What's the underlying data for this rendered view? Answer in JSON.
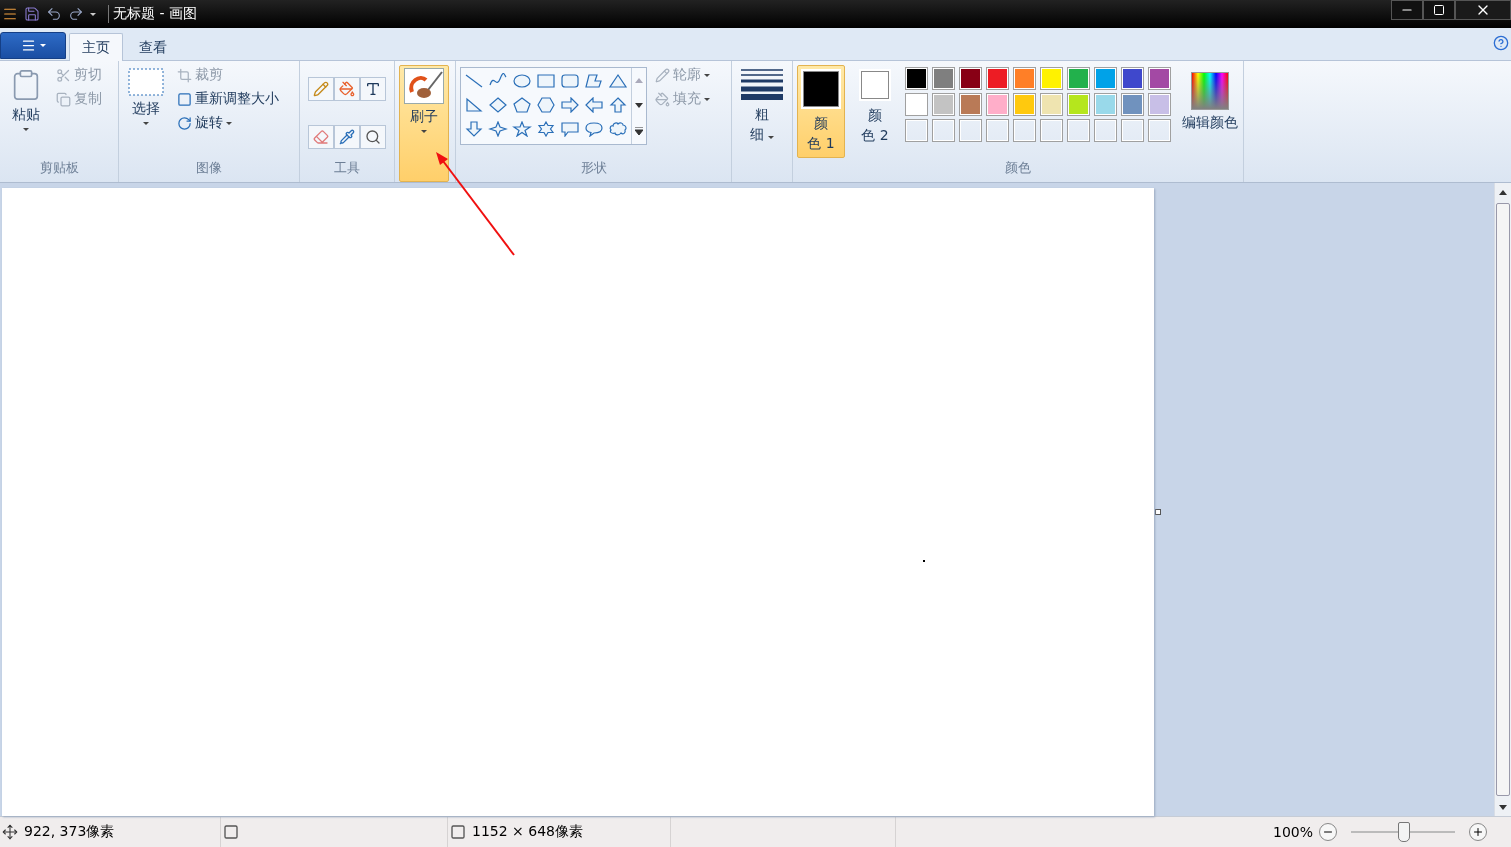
{
  "title_bar": {
    "title": "无标题 - 画图"
  },
  "tabs": [
    {
      "label": "主页",
      "selected": true
    },
    {
      "label": "查看",
      "selected": false
    }
  ],
  "clipboard": {
    "group_label": "剪贴板",
    "paste": "粘贴",
    "items": [
      {
        "label": "剪切",
        "disabled": true
      },
      {
        "label": "复制",
        "disabled": true
      }
    ]
  },
  "image": {
    "group_label": "图像",
    "select": "选择",
    "items": [
      {
        "label": "裁剪",
        "disabled": true,
        "dropdown": false
      },
      {
        "label": "重新调整大小",
        "disabled": false,
        "dropdown": false
      },
      {
        "label": "旋转",
        "disabled": false,
        "dropdown": true
      }
    ]
  },
  "tools": {
    "group_label": "工具"
  },
  "brush": {
    "label": "刷子",
    "selected": true
  },
  "shapes": {
    "group_label": "形状",
    "items": [
      {
        "label": "轮廓",
        "disabled": true
      },
      {
        "label": "填充",
        "disabled": true
      }
    ]
  },
  "size": {
    "lines": [
      "粗",
      "细"
    ]
  },
  "colors": {
    "group_label": "颜色",
    "pickers": [
      {
        "lines": [
          "颜",
          "色 1"
        ],
        "selected": true,
        "color": "#000000"
      },
      {
        "lines": [
          "颜",
          "色 2"
        ],
        "selected": false,
        "color": "#ffffff"
      }
    ],
    "swatches": [
      {
        "kind": "filled",
        "color": "#000000"
      },
      {
        "kind": "filled",
        "color": "#7f7f7f"
      },
      {
        "kind": "filled",
        "color": "#880015"
      },
      {
        "kind": "filled",
        "color": "#ed1c24"
      },
      {
        "kind": "filled",
        "color": "#ff7f27"
      },
      {
        "kind": "filled",
        "color": "#fff200"
      },
      {
        "kind": "filled",
        "color": "#22b14c"
      },
      {
        "kind": "filled",
        "color": "#00a2e8"
      },
      {
        "kind": "filled",
        "color": "#3f48cc"
      },
      {
        "kind": "filled",
        "color": "#a349a4"
      },
      {
        "kind": "filled",
        "color": "#ffffff"
      },
      {
        "kind": "filled",
        "color": "#c3c3c3"
      },
      {
        "kind": "filled",
        "color": "#b97a57"
      },
      {
        "kind": "filled",
        "color": "#ffaec9"
      },
      {
        "kind": "filled",
        "color": "#ffc90e"
      },
      {
        "kind": "filled",
        "color": "#efe4b0"
      },
      {
        "kind": "filled",
        "color": "#b5e61d"
      },
      {
        "kind": "filled",
        "color": "#99d9ea"
      },
      {
        "kind": "filled",
        "color": "#7092be"
      },
      {
        "kind": "filled",
        "color": "#c8bfe7"
      },
      {
        "kind": "empty"
      },
      {
        "kind": "empty"
      },
      {
        "kind": "empty"
      },
      {
        "kind": "empty"
      },
      {
        "kind": "empty"
      },
      {
        "kind": "empty"
      },
      {
        "kind": "empty"
      },
      {
        "kind": "empty"
      },
      {
        "kind": "empty"
      },
      {
        "kind": "empty"
      }
    ],
    "edit": "编辑颜色"
  },
  "status_bar": {
    "position": "922, 373像素",
    "canvas_size": "1152 × 648像素",
    "zoom": {
      "reading": "100%",
      "level": 0.5
    }
  }
}
